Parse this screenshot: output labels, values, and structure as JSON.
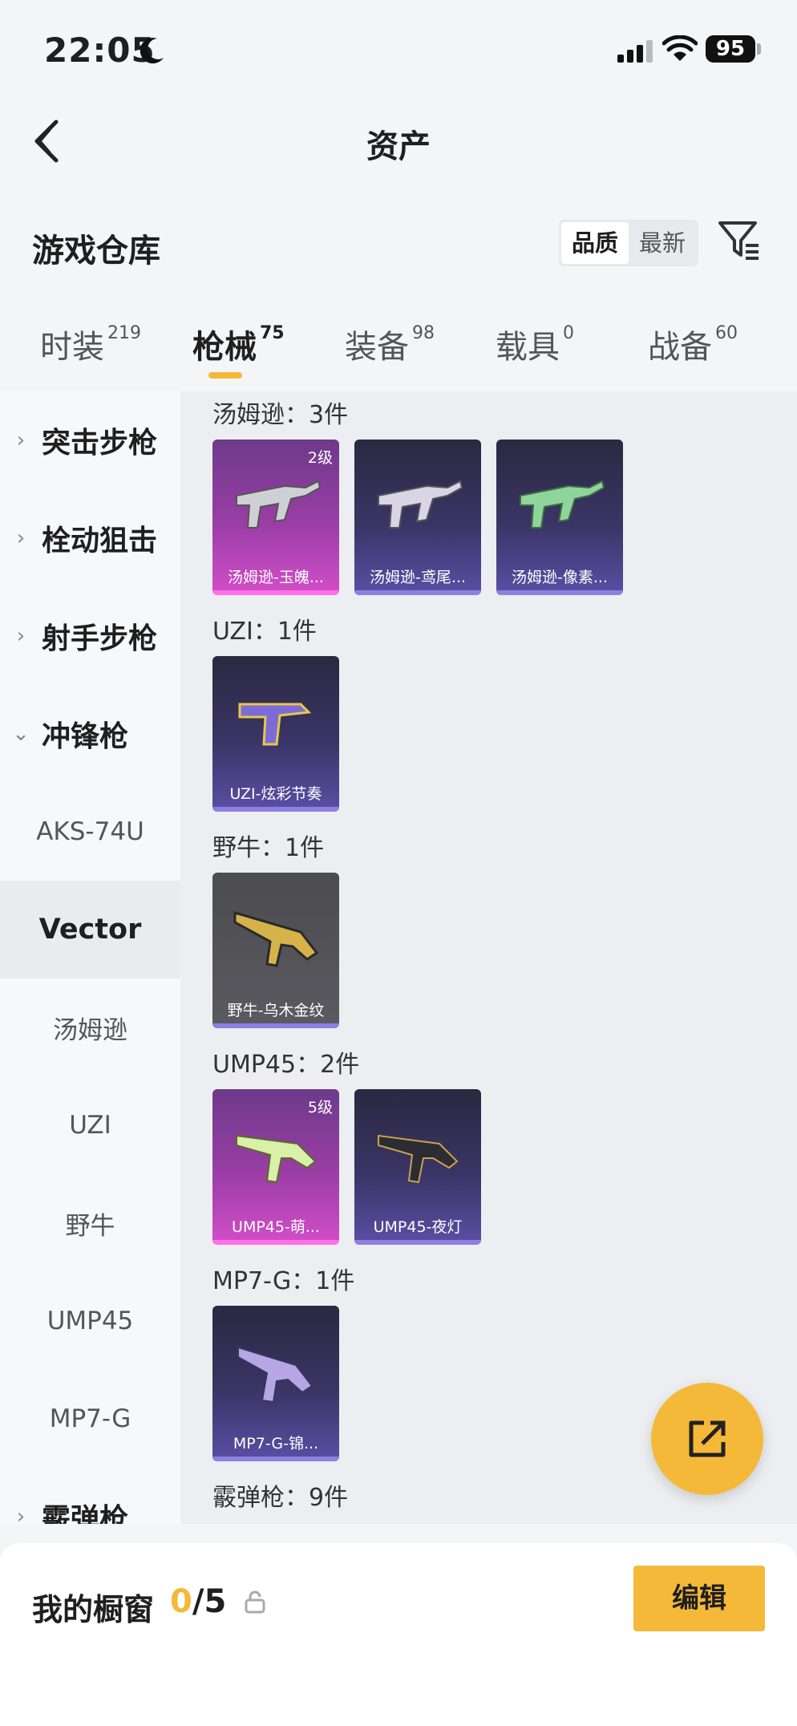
{
  "status_bar": {
    "time": "22:05",
    "battery": "95"
  },
  "nav": {
    "title": "资产"
  },
  "warehouse": {
    "title": "游戏仓库",
    "sort_options": [
      "品质",
      "最新"
    ]
  },
  "tabs": [
    {
      "label": "时装",
      "count": "219"
    },
    {
      "label": "枪械",
      "count": "75"
    },
    {
      "label": "装备",
      "count": "98"
    },
    {
      "label": "载具",
      "count": "0"
    },
    {
      "label": "战备",
      "count": "60"
    }
  ],
  "sidebar": {
    "categories": [
      "突击步枪",
      "栓动狙击",
      "射手步枪",
      "冲锋枪",
      "霰弹枪"
    ],
    "subitems": [
      "AKS-74U",
      "Vector",
      "汤姆逊",
      "UZI",
      "野牛",
      "UMP45",
      "MP7-G"
    ]
  },
  "groups": [
    {
      "label": "汤姆逊：3件",
      "items": [
        {
          "name": "汤姆逊-玉魄...",
          "level": "2级",
          "rarity": "pink"
        },
        {
          "name": "汤姆逊-鸢尾...",
          "level": "",
          "rarity": "purple"
        },
        {
          "name": "汤姆逊-像素...",
          "level": "",
          "rarity": "purple"
        }
      ]
    },
    {
      "label": "UZI：1件",
      "items": [
        {
          "name": "UZI-炫彩节奏",
          "level": "",
          "rarity": "purple"
        }
      ]
    },
    {
      "label": "野牛：1件",
      "items": [
        {
          "name": "野牛-乌木金纹",
          "level": "",
          "rarity": "gray"
        }
      ]
    },
    {
      "label": "UMP45：2件",
      "items": [
        {
          "name": "UMP45-萌...",
          "level": "5级",
          "rarity": "pink"
        },
        {
          "name": "UMP45-夜灯",
          "level": "",
          "rarity": "purple"
        }
      ]
    },
    {
      "label": "MP7-G：1件",
      "items": [
        {
          "name": "MP7-G-锦...",
          "level": "",
          "rarity": "purple"
        }
      ]
    },
    {
      "label": "霰弹枪：9件",
      "items": []
    }
  ],
  "showcase": {
    "label": "我的橱窗",
    "current": "0",
    "total": "/5"
  },
  "edit_label": "编辑"
}
